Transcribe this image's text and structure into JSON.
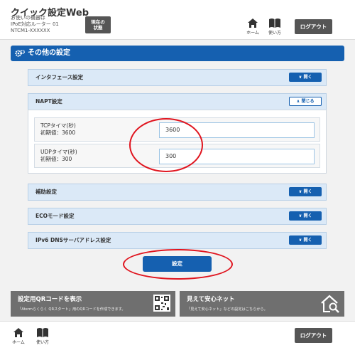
{
  "header": {
    "app_title": "クイック設定Web",
    "device_line1": "お使いの機器は",
    "device_line2": "IPoE対応ルーター 01",
    "device_line3": "NTCM1-XXXXXX",
    "status_label_line1": "現在の",
    "status_label_line2": "状態",
    "home_label": "ホーム",
    "help_label": "使い方",
    "logout_label": "ログアウト"
  },
  "page": {
    "title": "その他の設定"
  },
  "sections": {
    "interface": {
      "label": "インタフェース設定",
      "button": "開く"
    },
    "napt": {
      "label": "NAPT設定",
      "button": "閉じる"
    },
    "aux": {
      "label": "補助設定",
      "button": "開く"
    },
    "eco": {
      "label": "ECOモード設定",
      "button": "開く"
    },
    "ipv6dns": {
      "label": "IPv6 DNSサーバアドレス設定",
      "button": "開く"
    }
  },
  "napt_fields": {
    "tcp": {
      "label": "TCPタイマ(秒)",
      "default": "初期値：3600",
      "value": "3600"
    },
    "udp": {
      "label": "UDPタイマ(秒)",
      "default": "初期値：300",
      "value": "300"
    }
  },
  "actions": {
    "set_label": "設定"
  },
  "banners": {
    "qr": {
      "title": "設定用QRコードを表示",
      "sub": "「Atermらくらく QRスタート」用のQRコードを作成できます。"
    },
    "safe": {
      "title": "見えて安心ネット",
      "sub": "「見えて安心ネット」などの設定はこちらから。"
    }
  },
  "footer": {
    "home_label": "ホーム",
    "help_label": "使い方",
    "logout_label": "ログアウト"
  },
  "colors": {
    "accent": "#1560b0",
    "annotation": "#e0141e"
  }
}
